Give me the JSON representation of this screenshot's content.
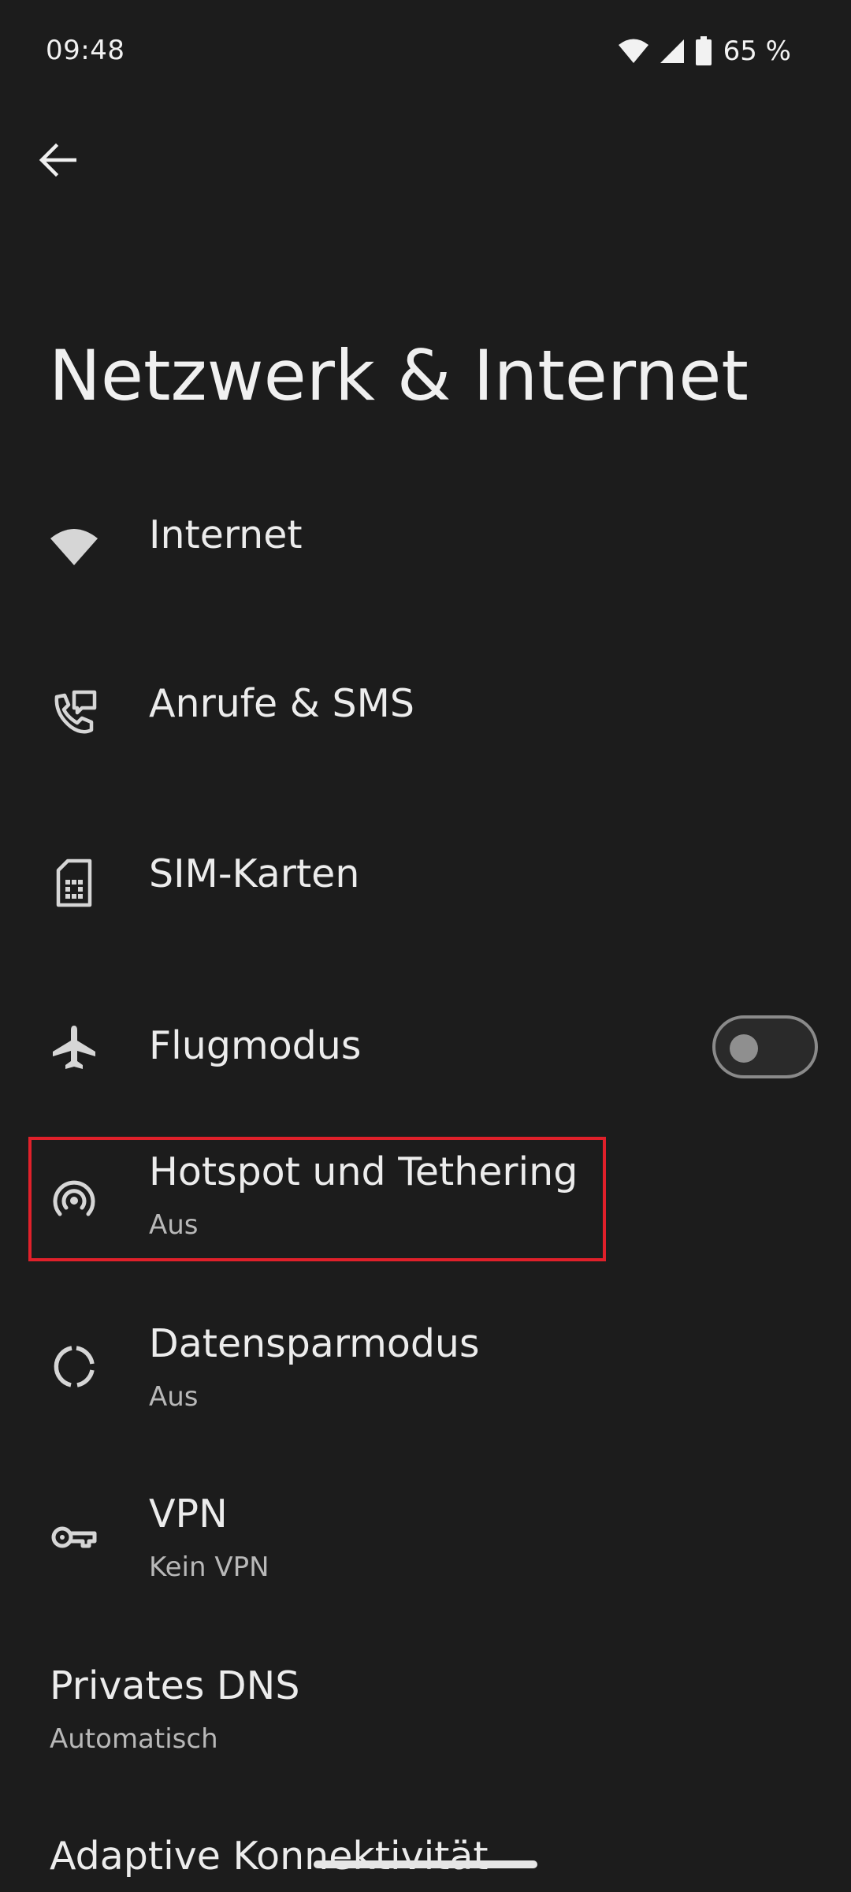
{
  "status_bar": {
    "time": "09:48",
    "battery": "65 %",
    "icons": [
      "wifi-icon",
      "cell-signal-icon",
      "battery-icon"
    ]
  },
  "header": {
    "back_icon": "arrow-back-icon",
    "title": "Netzwerk & Internet"
  },
  "items": [
    {
      "title": "Internet",
      "icon": "wifi-icon"
    },
    {
      "title": "Anrufe & SMS",
      "icon": "phone-sms-icon"
    },
    {
      "title": "SIM-Karten",
      "icon": "sim-card-icon"
    },
    {
      "title": "Flugmodus",
      "icon": "airplane-icon",
      "toggle": "off"
    },
    {
      "title": "Hotspot und Tethering",
      "subtitle": "Aus",
      "icon": "hotspot-icon",
      "highlighted": true
    },
    {
      "title": "Datensparmodus",
      "subtitle": "Aus",
      "icon": "data-saver-icon"
    },
    {
      "title": "VPN",
      "subtitle": "Kein VPN",
      "icon": "key-icon"
    },
    {
      "title": "Privates DNS",
      "subtitle": "Automatisch"
    },
    {
      "title": "Adaptive Konnektivität"
    }
  ],
  "colors": {
    "background": "#1c1c1c",
    "text": "#ececec",
    "subtext": "#b8b8b8",
    "highlight": "#e0202a"
  }
}
